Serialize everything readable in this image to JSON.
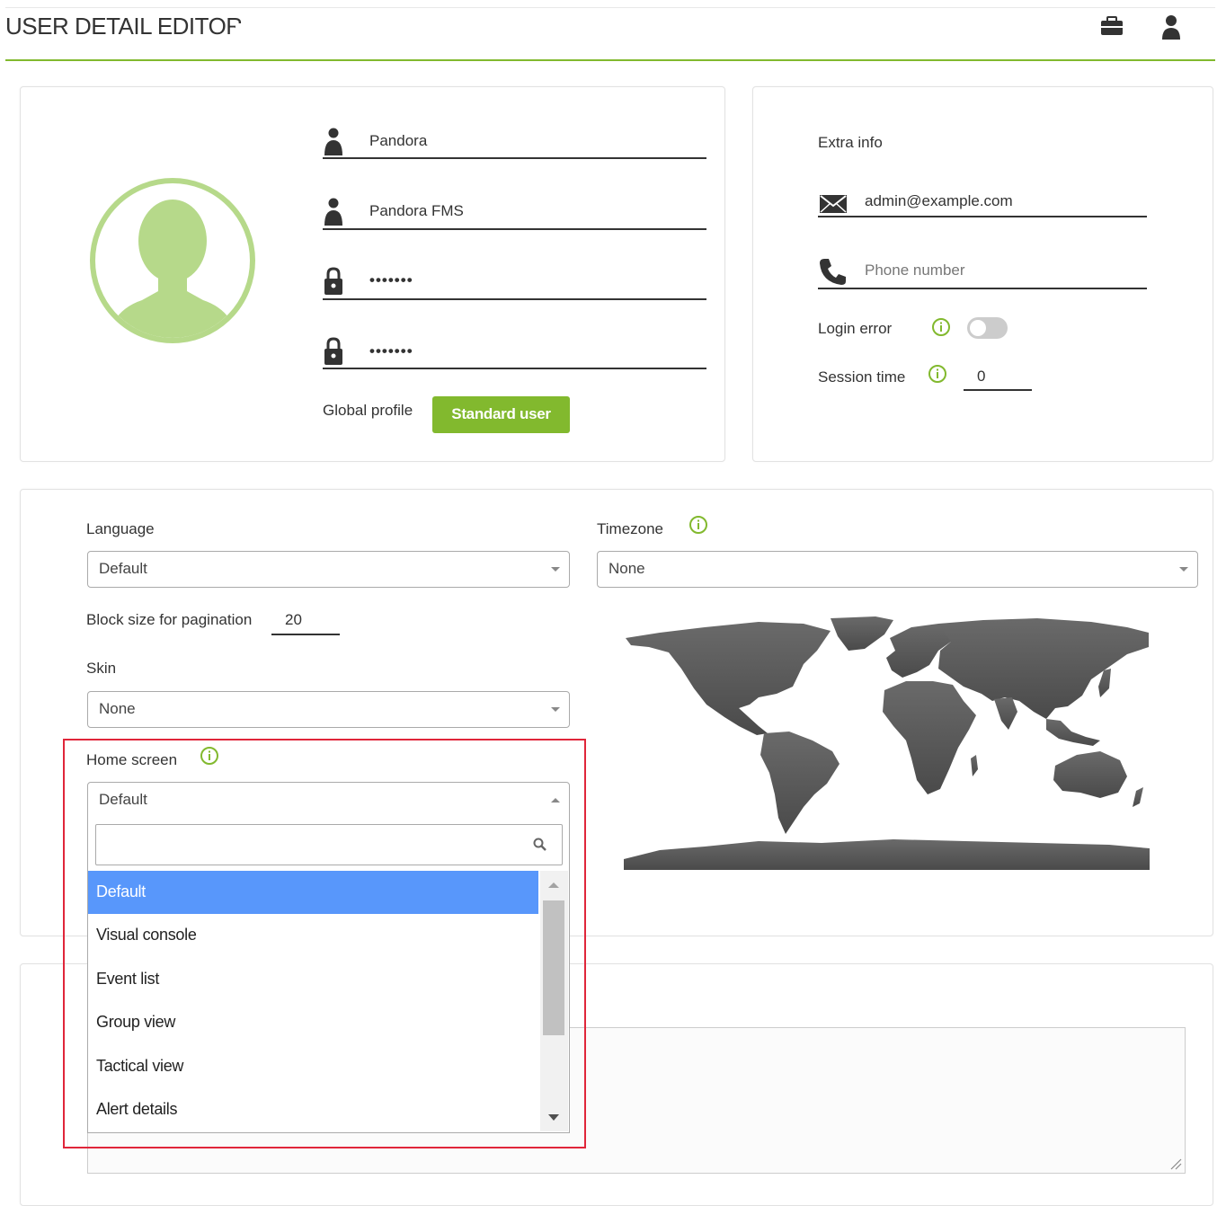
{
  "header": {
    "title": "USER DETAIL EDITOR",
    "icons": [
      "briefcase-icon",
      "user-icon"
    ]
  },
  "profile_card": {
    "avatar_icon": "user-avatar-icon",
    "fields": [
      {
        "icon": "user-icon",
        "value": "Pandora"
      },
      {
        "icon": "user-icon",
        "value": "Pandora FMS"
      },
      {
        "icon": "lock-icon",
        "value": "•••••••"
      },
      {
        "icon": "lock-icon",
        "value": "•••••••"
      }
    ],
    "global_profile_label": "Global profile",
    "global_profile_button": "Standard user"
  },
  "extra_card": {
    "title": "Extra info",
    "email": "admin@example.com",
    "phone_placeholder": "Phone number",
    "login_error_label": "Login error",
    "login_error_enabled": false,
    "session_time_label": "Session time",
    "session_time_value": "0"
  },
  "settings": {
    "language_label": "Language",
    "language_value": "Default",
    "timezone_label": "Timezone",
    "timezone_value": "None",
    "block_size_label": "Block size for pagination",
    "block_size_value": "20",
    "skin_label": "Skin",
    "skin_value": "None",
    "home_screen_label": "Home screen",
    "home_screen_value": "Default",
    "home_screen_search": "",
    "home_screen_options": [
      "Default",
      "Visual console",
      "Event list",
      "Group view",
      "Tactical view",
      "Alert details"
    ],
    "home_screen_selected_index": 0
  },
  "colors": {
    "accent": "#82b92e",
    "avatar": "#b6d98a",
    "info_icon": "#82b92e",
    "dropdown_selected": "#5897fb",
    "highlight_box": "#e0263a",
    "map": "#555555"
  }
}
